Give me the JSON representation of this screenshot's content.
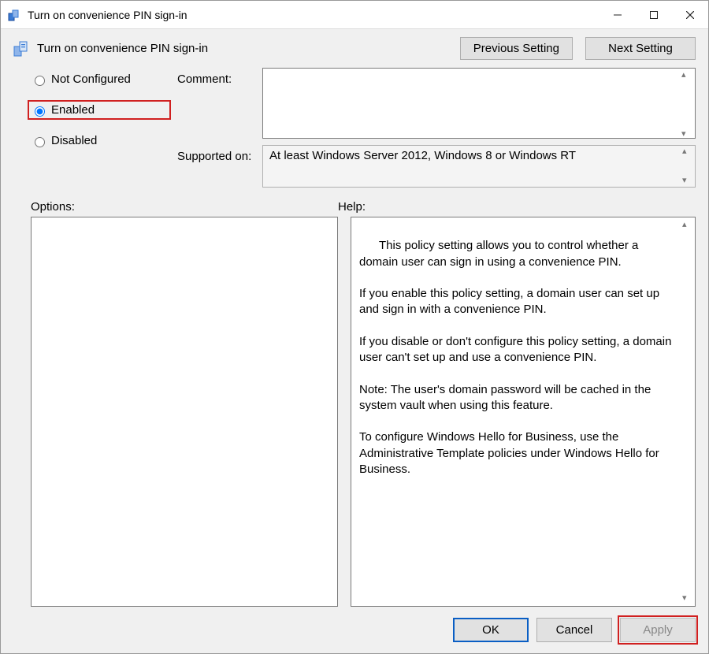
{
  "window": {
    "title": "Turn on convenience PIN sign-in"
  },
  "header": {
    "title": "Turn on convenience PIN sign-in",
    "prev_label": "Previous Setting",
    "next_label": "Next Setting"
  },
  "radios": {
    "not_configured": "Not Configured",
    "enabled": "Enabled",
    "disabled": "Disabled",
    "selected": "enabled"
  },
  "labels": {
    "comment": "Comment:",
    "supported_on": "Supported on:",
    "options": "Options:",
    "help": "Help:"
  },
  "comment_value": "",
  "supported_on_value": "At least Windows Server 2012, Windows 8 or Windows RT",
  "options_content": "",
  "help_content": "This policy setting allows you to control whether a domain user can sign in using a convenience PIN.\n\nIf you enable this policy setting, a domain user can set up and sign in with a convenience PIN.\n\nIf you disable or don't configure this policy setting, a domain user can't set up and use a convenience PIN.\n\nNote: The user's domain password will be cached in the system vault when using this feature.\n\nTo configure Windows Hello for Business, use the Administrative Template policies under Windows Hello for Business.",
  "footer": {
    "ok": "OK",
    "cancel": "Cancel",
    "apply": "Apply"
  }
}
